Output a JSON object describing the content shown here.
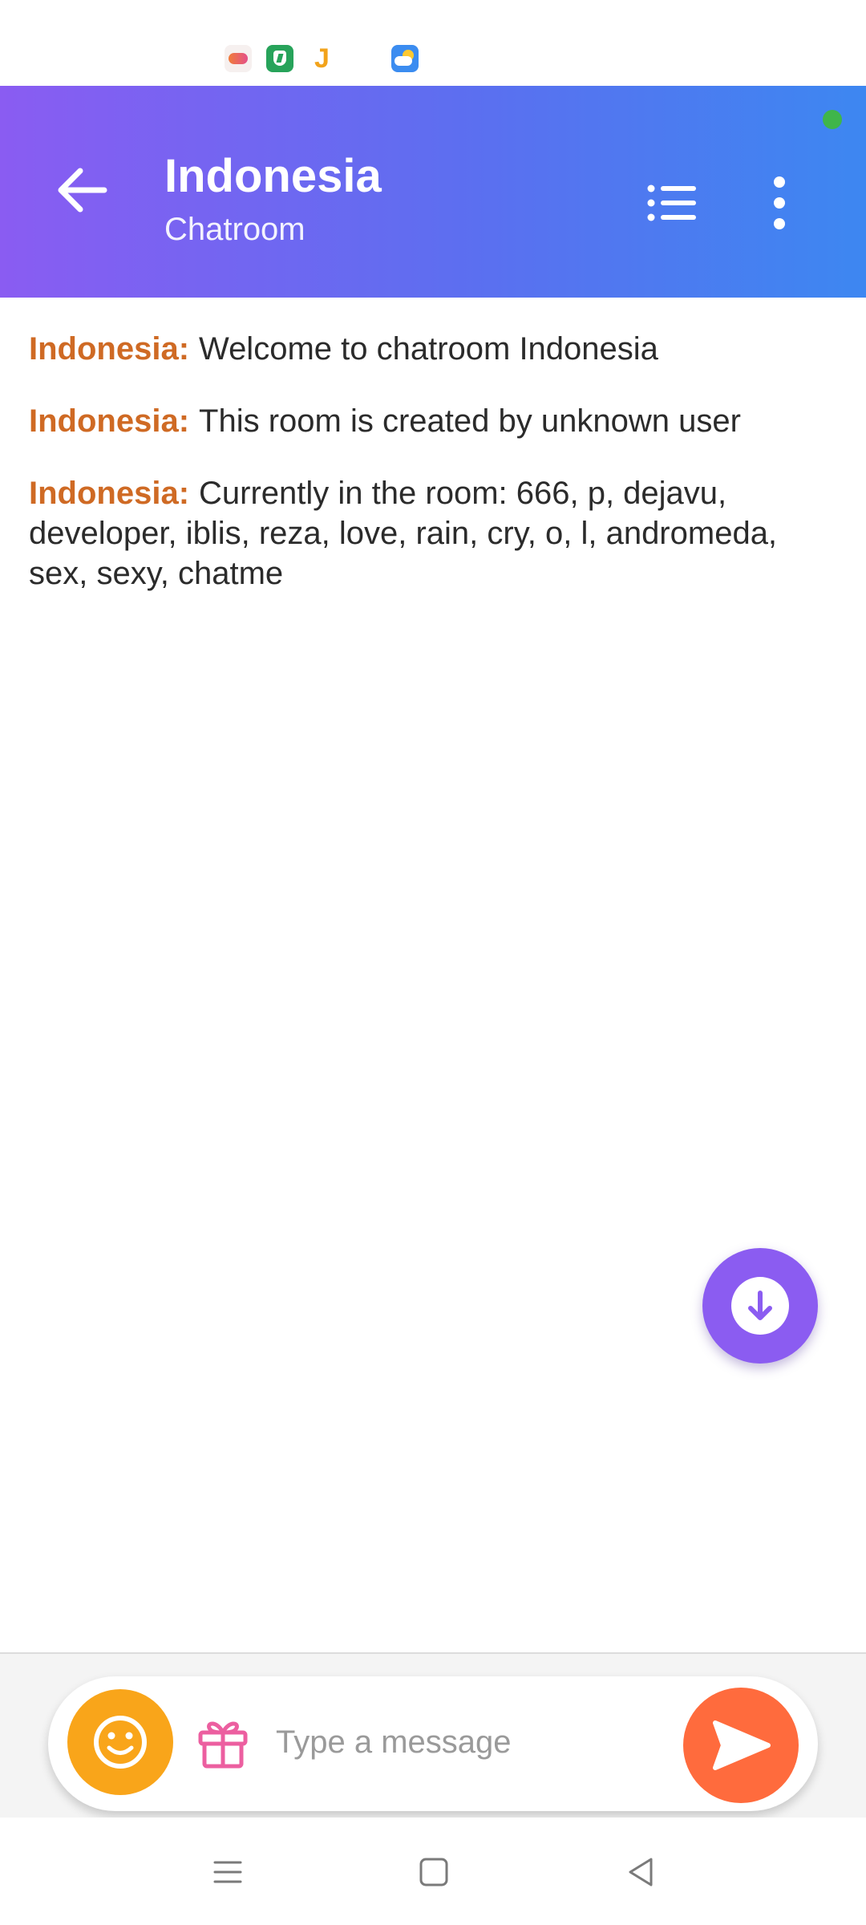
{
  "header": {
    "title": "Indonesia",
    "subtitle": "Chatroom",
    "icons": [
      "arrow-left-icon",
      "list-icon",
      "more-vert-icon"
    ],
    "accent_gradient": [
      "#8a5cf2",
      "#3d87f1"
    ],
    "online_color": "#3fb54a"
  },
  "messages": [
    {
      "sender": "Indonesia:",
      "text": "Welcome to chatroom Indonesia"
    },
    {
      "sender": "Indonesia:",
      "text": "This room is created by unknown user"
    },
    {
      "sender": "Indonesia:",
      "text": "Currently in the room: 666, p, dejavu, developer, iblis, reza, love, rain, cry, o, l, andromeda, sex, sexy, chatme"
    }
  ],
  "colors": {
    "sender": "#cf6a24",
    "fab": "#8b5cf1",
    "emoji_button": "#f9a51a",
    "send_button": "#ff6b3d",
    "gift_icon": "#ec5fa0"
  },
  "composer": {
    "placeholder": "Type a message",
    "icons": [
      "smile-icon",
      "gift-icon",
      "send-icon"
    ]
  },
  "fab": {
    "icon": "arrow-down-circle-icon"
  },
  "status_bar": {
    "icons": [
      "game-icon",
      "shield-icon",
      "j-app-icon",
      "weather-icon"
    ]
  },
  "nav": {
    "icons": [
      "menu-icon",
      "home-icon",
      "back-icon"
    ]
  }
}
